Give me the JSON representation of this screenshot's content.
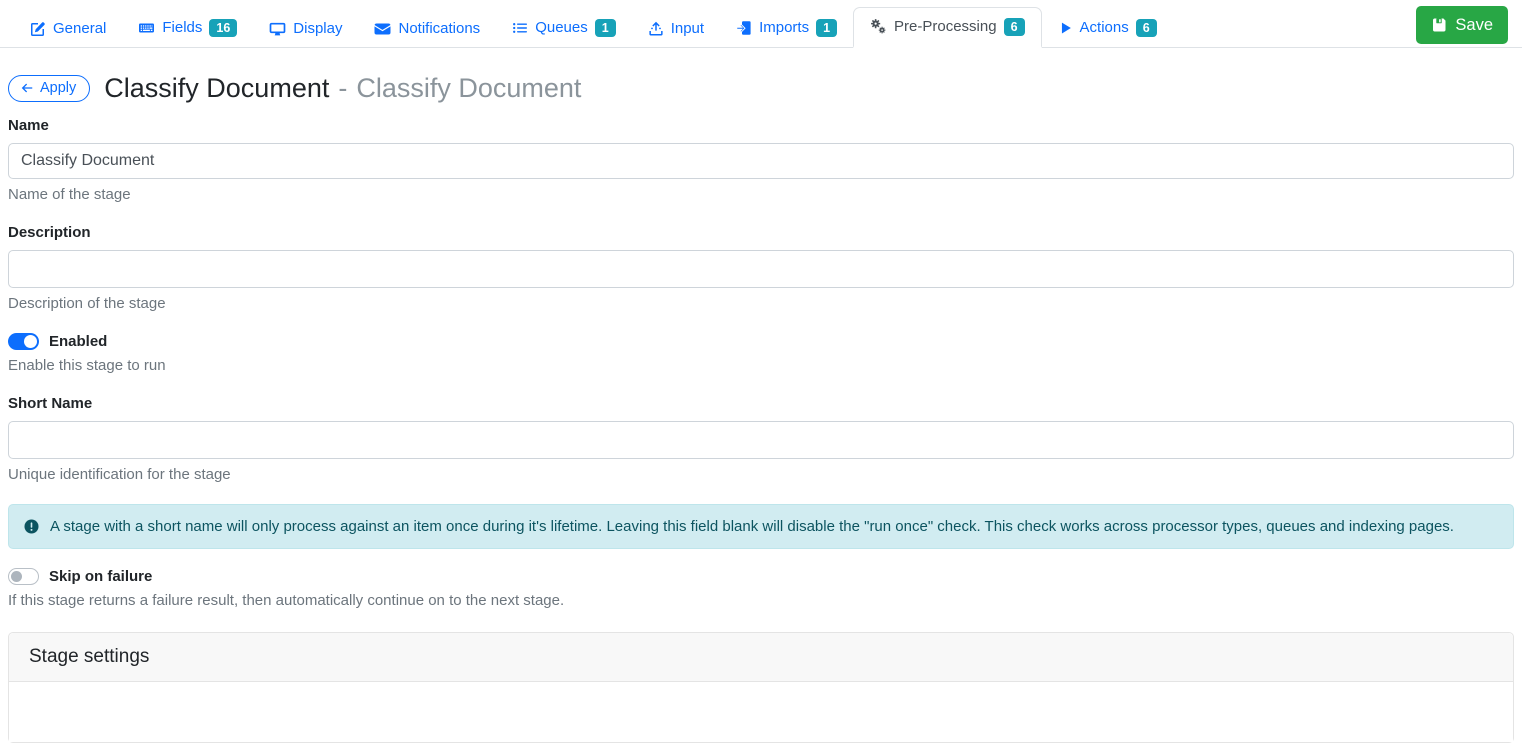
{
  "colors": {
    "accent_blue": "#0d6efd",
    "badge_teal": "#17a2b8",
    "save_green": "#28a745",
    "alert_bg": "#d1ecf1",
    "alert_text": "#0c5460"
  },
  "tabs": [
    {
      "label": "General",
      "icon": "pencil-square-icon"
    },
    {
      "label": "Fields",
      "icon": "keyboard-icon",
      "badge": "16"
    },
    {
      "label": "Display",
      "icon": "display-icon"
    },
    {
      "label": "Notifications",
      "icon": "envelope-icon"
    },
    {
      "label": "Queues",
      "icon": "list-icon",
      "badge": "1"
    },
    {
      "label": "Input",
      "icon": "upload-icon"
    },
    {
      "label": "Imports",
      "icon": "file-import-icon",
      "badge": "1"
    },
    {
      "label": "Pre-Processing",
      "icon": "gears-icon",
      "badge": "6",
      "active": true
    },
    {
      "label": "Actions",
      "icon": "play-icon",
      "badge": "6"
    }
  ],
  "toolbar": {
    "save_label": "Save",
    "save_icon": "floppy-save-icon"
  },
  "header": {
    "apply_label": "Apply",
    "apply_icon": "arrow-left-icon",
    "title": "Classify Document",
    "separator": "-",
    "subtitle": "Classify Document"
  },
  "form": {
    "name": {
      "label": "Name",
      "value": "Classify Document",
      "help": "Name of the stage"
    },
    "description": {
      "label": "Description",
      "value": "",
      "help": "Description of the stage"
    },
    "enabled": {
      "label": "Enabled",
      "state": "on",
      "help": "Enable this stage to run"
    },
    "short_name": {
      "label": "Short Name",
      "value": "",
      "help": "Unique identification for the stage"
    },
    "short_name_info": "A stage with a short name will only process against an item once during it's lifetime. Leaving this field blank will disable the \"run once\" check. This check works across processor types, queues and indexing pages.",
    "info_icon": "exclamation-circle-icon",
    "skip_on_failure": {
      "label": "Skip on failure",
      "state": "off",
      "help": "If this stage returns a failure result, then automatically continue on to the next stage."
    }
  },
  "stage_settings": {
    "title": "Stage settings"
  }
}
